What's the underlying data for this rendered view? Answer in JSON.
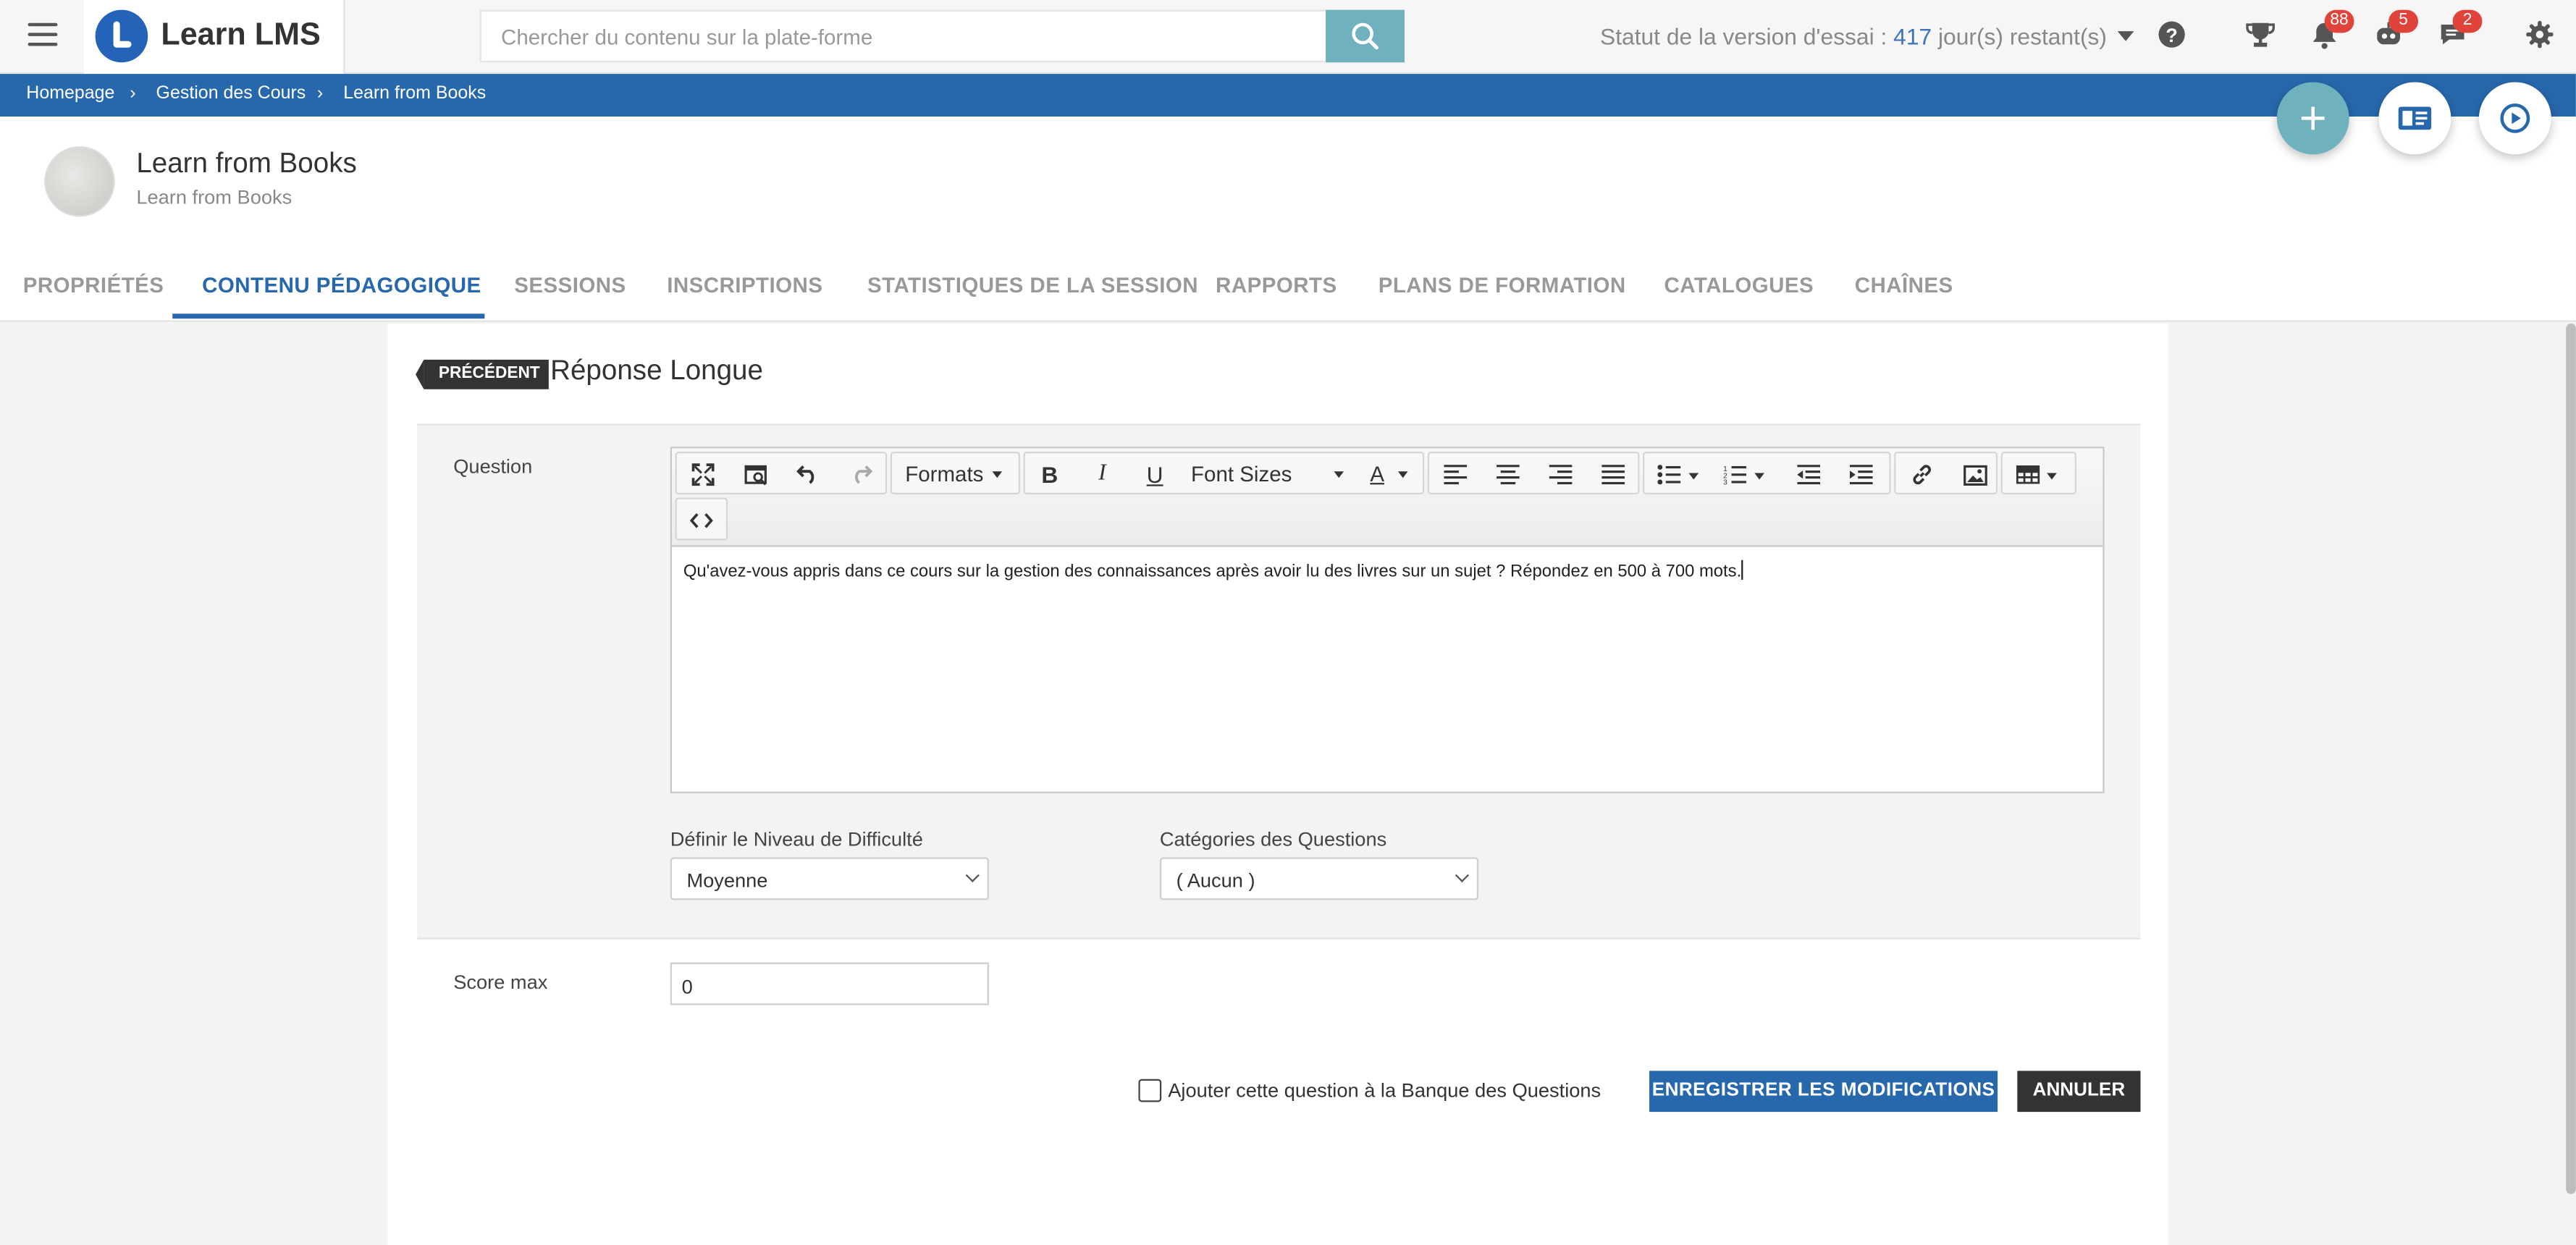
{
  "app": {
    "name": "Learn LMS"
  },
  "search": {
    "placeholder": "Chercher du contenu sur la plate-forme"
  },
  "trial": {
    "label": "Statut de la version d'essai :",
    "days": "417",
    "suffix": "jour(s) restant(s)"
  },
  "badges": {
    "notifications": "88",
    "robot": "5",
    "messages": "2"
  },
  "breadcrumb": [
    "Homepage",
    "Gestion des Cours",
    "Learn from Books"
  ],
  "course": {
    "title": "Learn from Books",
    "subtitle": "Learn from Books"
  },
  "tabs": [
    "PROPRIÉTÉS",
    "CONTENU PÉDAGOGIQUE",
    "SESSIONS",
    "INSCRIPTIONS",
    "STATISTIQUES DE LA SESSION",
    "RAPPORTS",
    "PLANS DE FORMATION",
    "CATALOGUES",
    "CHAÎNES"
  ],
  "active_tab": "CONTENU PÉDAGOGIQUE",
  "question_page": {
    "prev_label": "PRÉCÉDENT",
    "title": "Réponse Longue",
    "question_label": "Question",
    "toolbar": {
      "formats": "Formats",
      "font_sizes": "Font Sizes",
      "text_color": "A"
    },
    "question_text": "Qu'avez-vous appris dans ce cours sur la gestion des connaissances après avoir lu des livres sur un sujet ? Répondez en 500 à 700 mots.",
    "difficulty": {
      "label": "Définir le Niveau de Difficulté",
      "value": "Moyenne"
    },
    "categories": {
      "label": "Catégories des Questions",
      "value": "( Aucun )"
    },
    "score": {
      "label": "Score max",
      "value": "0"
    },
    "bank_checkbox": {
      "label": "Ajouter cette question à la Banque des Questions",
      "checked": false
    },
    "save_label": "ENREGISTRER LES MODIFICATIONS",
    "cancel_label": "ANNULER"
  },
  "colors": {
    "primary": "#2768ac",
    "teal": "#6fb1bd",
    "badge": "#e0433a",
    "dark": "#333333"
  }
}
